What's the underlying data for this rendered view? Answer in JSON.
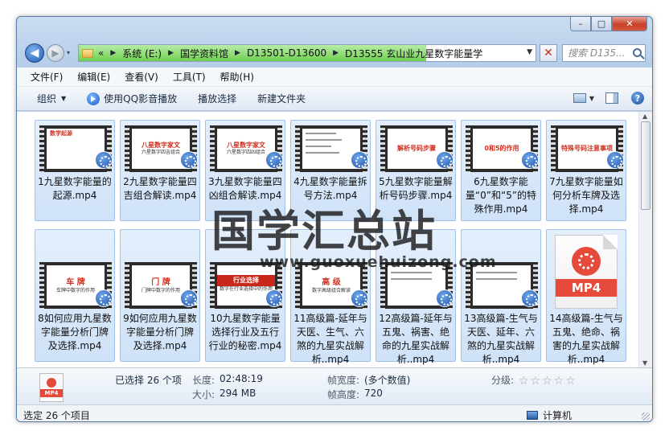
{
  "window": {
    "caption_buttons": {
      "minimize": "–",
      "maximize": "□",
      "close": "✕"
    }
  },
  "nav": {
    "back_glyph": "◀",
    "forward_glyph": "▶",
    "history_glyph": "▾",
    "address_progress": 0.76,
    "breadcrumb_prefix": "«",
    "breadcrumbs": [
      "系统 (E:)",
      "国学资料馆",
      "D13501-D13600",
      "D13555 玄山业九星数字能量学"
    ],
    "search_placeholder": "搜索 D135...",
    "refresh_glyph": "✕"
  },
  "menu": [
    "文件(F)",
    "编辑(E)",
    "查看(V)",
    "工具(T)",
    "帮助(H)"
  ],
  "toolbar": {
    "organize": "组织",
    "play_qq": "使用QQ影音播放",
    "play_select": "播放选择",
    "new_folder": "新建文件夹",
    "help_glyph": "?"
  },
  "files": [
    {
      "name": "1九星数字能量的起源.mp4",
      "slide": "数学起源",
      "sub": ""
    },
    {
      "name": "2九星数字能量四吉组合解读.mp4",
      "slide": "八星数字家文",
      "sub": "六星数字四吉组合"
    },
    {
      "name": "3九星数字能量四凶组合解读.mp4",
      "slide": "八星数字家文",
      "sub": "六星数字四凶组合"
    },
    {
      "name": "4九星数字能量拆号方法.mp4",
      "slide": "",
      "sub": ""
    },
    {
      "name": "5九星数字能量解析号码步骤.mp4",
      "slide": "解析号码步骤",
      "sub": ""
    },
    {
      "name": "6九星数字能量“0”和“5”的特殊作用.mp4",
      "slide": "0和5的作用",
      "sub": ""
    },
    {
      "name": "7九星数字能量如何分析车牌及选择.mp4",
      "slide": "特殊号码注意事项",
      "sub": ""
    },
    {
      "name": "8如何应用九星数字能量分析门牌及选择.mp4",
      "slide": "车 牌",
      "sub": "车牌中数字的作用"
    },
    {
      "name": "9如何应用九星数字能量分析门牌及选择.mp4",
      "slide": "门 牌",
      "sub": "门牌中数字的作用"
    },
    {
      "name": "10九星数字能量选择行业及五行行业的秘密.mp4",
      "slide": "行业选择",
      "sub": "数字在行业选择中的作用"
    },
    {
      "name": "11高级篇-延年与天医、生气、六煞的九星实战解析..mp4",
      "slide": "高 级",
      "sub": "数字高级组合解读"
    },
    {
      "name": "12高级篇-延年与五鬼、祸害、绝命的九星实战解析..mp4",
      "slide": "",
      "sub": ""
    },
    {
      "name": "13高级篇-生气与天医、延年、六煞的九星实战解析..mp4",
      "slide": "",
      "sub": ""
    },
    {
      "name": "14高级篇-生气与五鬼、绝命、祸害的九星实战解析..mp4",
      "slide": "",
      "sub": ""
    }
  ],
  "generic_file_label": "MP4",
  "watermark": {
    "text": "国学汇总站",
    "url": "www.guoxuehuizong.com"
  },
  "details": {
    "selected": "已选择 26 个项",
    "duration_label": "长度:",
    "duration": "02:48:19",
    "size_label": "大小:",
    "size": "294 MB",
    "frame_width_label": "帧宽度:",
    "frame_width": "(多个数值)",
    "frame_height_label": "帧高度:",
    "frame_height": "720",
    "rating_label": "分级:",
    "rating_stars": "☆☆☆☆☆"
  },
  "status": {
    "left": "选定 26 个项目",
    "right": "计算机"
  },
  "scrollbar": {
    "up_glyph": "▲",
    "down_glyph": "▼"
  }
}
